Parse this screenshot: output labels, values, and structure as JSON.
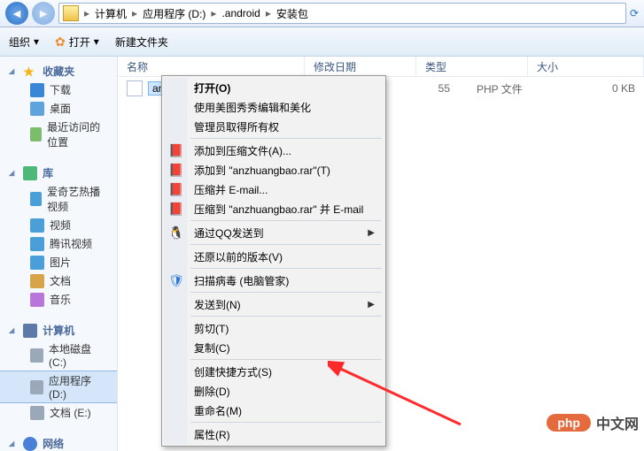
{
  "breadcrumbs": [
    "计算机",
    "应用程序 (D:)",
    ".android",
    "安装包"
  ],
  "toolbar": {
    "organize": "组织",
    "open": "打开",
    "newfolder": "新建文件夹"
  },
  "columns": {
    "name": "名称",
    "date": "修改日期",
    "type": "类型",
    "size": "大小"
  },
  "file": {
    "name": "anzh",
    "date_suffix": "55",
    "type": "PHP 文件",
    "size": "0 KB"
  },
  "nav": {
    "favorites": {
      "header": "收藏夹",
      "downloads": "下载",
      "desktop": "桌面",
      "recent": "最近访问的位置"
    },
    "libraries": {
      "header": "库",
      "aiqiyi": "爱奇艺热播视频",
      "video": "视频",
      "tencent": "腾讯视频",
      "pictures": "图片",
      "docs": "文档",
      "music": "音乐"
    },
    "computer": {
      "header": "计算机",
      "c": "本地磁盘 (C:)",
      "d": "应用程序 (D:)",
      "e": "文档 (E:)"
    },
    "network": {
      "header": "网络"
    }
  },
  "ctx": {
    "open": "打开(O)",
    "meitu": "使用美图秀秀编辑和美化",
    "admin": "管理员取得所有权",
    "addcompress": "添加到压缩文件(A)...",
    "addtorar": "添加到 \"anzhuangbao.rar\"(T)",
    "emailzip": "压缩并 E-mail...",
    "emailrar": "压缩到 \"anzhuangbao.rar\" 并 E-mail",
    "qq": "通过QQ发送到",
    "restore": "还原以前的版本(V)",
    "scan": "扫描病毒 (电脑管家)",
    "sendto": "发送到(N)",
    "cut": "剪切(T)",
    "copy": "复制(C)",
    "shortcut": "创建快捷方式(S)",
    "delete": "删除(D)",
    "rename": "重命名(M)",
    "props": "属性(R)"
  },
  "watermark": {
    "pill": "php",
    "text": "中文网"
  }
}
